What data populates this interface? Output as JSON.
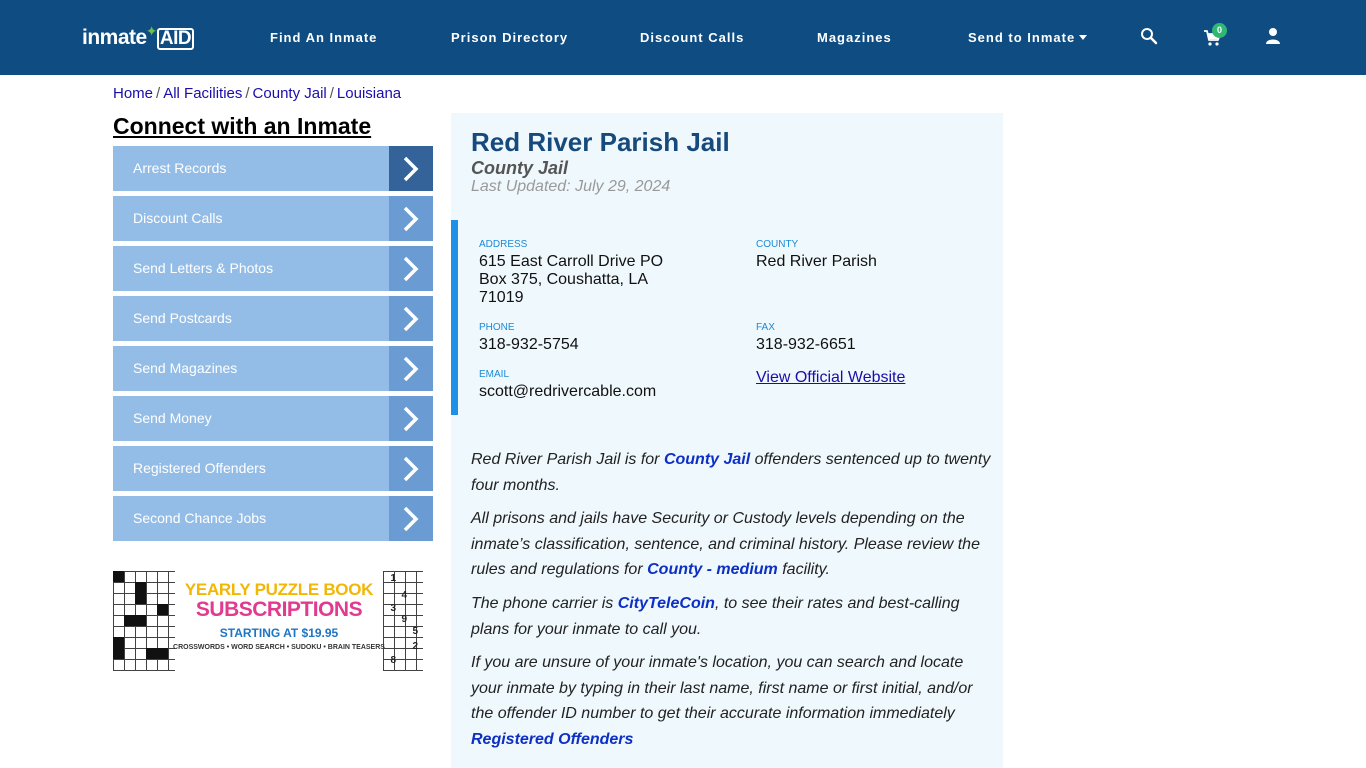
{
  "header": {
    "logo": {
      "part1": "inmate",
      "part2": "AID"
    },
    "nav": [
      {
        "label": "Find An Inmate"
      },
      {
        "label": "Prison Directory"
      },
      {
        "label": "Discount Calls"
      },
      {
        "label": "Magazines"
      },
      {
        "label": "Send to Inmate"
      }
    ],
    "cart_count": "0",
    "colors": {
      "bar": "#0f4c81",
      "badge": "#2fb872"
    }
  },
  "breadcrumb": {
    "items": [
      "Home",
      "All Facilities",
      "County Jail",
      "Louisiana"
    ],
    "separator": "/"
  },
  "sidebar": {
    "title": "Connect with an Inmate",
    "items": [
      {
        "label": "Arrest Records"
      },
      {
        "label": "Discount Calls"
      },
      {
        "label": "Send Letters & Photos"
      },
      {
        "label": "Send Postcards"
      },
      {
        "label": "Send Magazines"
      },
      {
        "label": "Send Money"
      },
      {
        "label": "Registered Offenders"
      },
      {
        "label": "Second Chance Jobs"
      }
    ],
    "ad": {
      "line1": "YEARLY PUZZLE BOOK",
      "line2": "SUBSCRIPTIONS",
      "line3": "STARTING AT $19.95",
      "line4": "CROSSWORDS • WORD SEARCH • SUDOKU • BRAIN TEASERS",
      "digits": [
        "1",
        "4",
        "9",
        "5",
        "2",
        "3",
        "8"
      ]
    }
  },
  "facility": {
    "name": "Red River Parish Jail",
    "type": "County Jail",
    "updated": "Last Updated: July 29, 2024",
    "address_label": "ADDRESS",
    "address": "615 East Carroll Drive PO Box 375, Coushatta, LA 71019",
    "county_label": "COUNTY",
    "county": "Red River Parish",
    "phone_label": "PHONE",
    "phone": "318-932-5754",
    "fax_label": "FAX",
    "fax": "318-932-6651",
    "email_label": "EMAIL",
    "email": "scott@redrivercable.com",
    "website_link": "View Official Website"
  },
  "description": {
    "p1_pre": "Red River Parish Jail is for ",
    "p1_link": "County Jail",
    "p1_post": " offenders sentenced up to twenty four months.",
    "p2_pre": "All prisons and jails have Security or Custody levels depending on the inmate’s classification, sentence, and criminal history. Please review the rules and regulations for ",
    "p2_link": "County - medium",
    "p2_post": " facility.",
    "p3_pre": "The phone carrier is ",
    "p3_link": "CityTeleCoin",
    "p3_post": ", to see their rates and best-calling plans for your inmate to call you.",
    "p4_text": "If you are unsure of your inmate's location, you can search and locate your inmate by typing in their last name, first name or first initial, and/or the offender ID number to get their accurate information immediately",
    "p4_link": "Registered Offenders"
  }
}
